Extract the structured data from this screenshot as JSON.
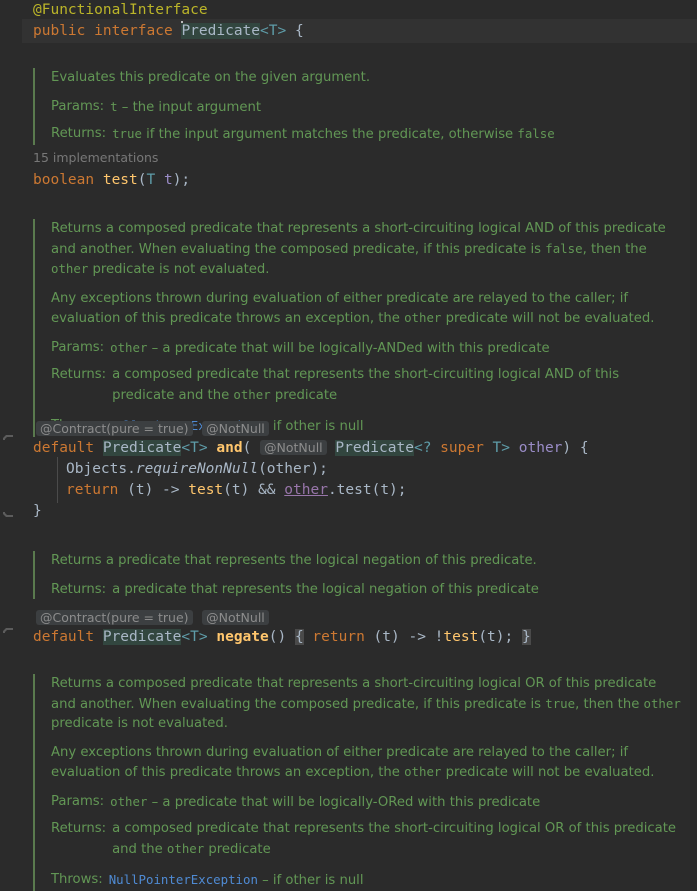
{
  "editor": {
    "theme": "darcula",
    "background": "#2b2b2b",
    "caret_line_background": "#323232",
    "doc_accent": "#5a7a4e",
    "keyword_color": "#cc7832",
    "method_color": "#ffc66d",
    "doc_text_color": "#629755",
    "link_color": "#4f8bd4",
    "hint_color": "#8c8c8c"
  },
  "code": {
    "annotation_line": "@FunctionalInterface",
    "declaration": {
      "kw_public": "public",
      "kw_interface": "interface",
      "name": "Predicate",
      "generic": "<T>",
      "brace": "{"
    },
    "test_method": {
      "code_vision": "15 implementations",
      "kw_boolean": "boolean",
      "name": "test",
      "open_paren": "(",
      "param_type": "T",
      "param_name": "t",
      "close": ");"
    },
    "and_method": {
      "hints": [
        "@Contract(pure = true)",
        "@NotNull"
      ],
      "kw_default": "default",
      "return_type": "Predicate",
      "return_generic": "<T>",
      "name": "and",
      "open_paren": "(",
      "param_hint": "@NotNull",
      "param_type": "Predicate",
      "param_generic": "<? ",
      "kw_super": "super",
      "param_generic_tail": " T>",
      "param_name": "other",
      "close_paren": ")",
      "open_brace": "{",
      "body": [
        {
          "obj": "Objects",
          "dot": ".",
          "call": "requireNonNull",
          "args": "(other);"
        },
        {
          "kw": "return",
          "lambda": " (t) -> ",
          "call1": "test",
          "call1args": "(t) ",
          "op": "&&",
          "ref": "other",
          "tail": ".test(t);"
        }
      ],
      "close_brace": "}"
    },
    "negate_method": {
      "hints": [
        "@Contract(pure = true)",
        "@NotNull"
      ],
      "kw_default": "default",
      "return_type": "Predicate",
      "return_generic": "<T>",
      "name": "negate",
      "parens": "()",
      "open_brace": "{",
      "kw_return": "return",
      "lambda": " (t) -> !",
      "call": "test",
      "call_args": "(t);",
      "close_brace": "}"
    }
  },
  "docs": {
    "test": {
      "summary": "Evaluates this predicate on the given argument.",
      "params_label": "Params:",
      "param_name": "t",
      "param_dash": "–",
      "param_desc": "the input argument",
      "returns_label": "Returns:",
      "returns_pre": "",
      "returns_true": "true",
      "returns_mid": " if the input argument matches the predicate, otherwise ",
      "returns_false": "false"
    },
    "and": {
      "para1_a": "Returns a composed predicate that represents a short-circuiting logical AND of this predicate and another. When evaluating the composed predicate, if this predicate is ",
      "para1_false": "false",
      "para1_b": ", then the ",
      "para1_other": "other",
      "para1_c": " predicate is not evaluated.",
      "para2_a": "Any exceptions thrown during evaluation of either predicate are relayed to the caller; if evaluation of this predicate throws an exception, the ",
      "para2_other": "other",
      "para2_b": " predicate will not be evaluated.",
      "params_label": "Params:",
      "param_name": "other",
      "param_dash": "–",
      "param_desc": "a predicate that will be logically-ANDed with this predicate",
      "returns_label": "Returns:",
      "returns_a": "a composed predicate that represents the short-circuiting logical AND of this predicate and the ",
      "returns_other": "other",
      "returns_b": " predicate",
      "throws_label": "Throws:",
      "throws_type": "NullPointerException",
      "throws_dash": "–",
      "throws_desc": "if other is null"
    },
    "negate": {
      "summary": "Returns a predicate that represents the logical negation of this predicate.",
      "returns_label": "Returns:",
      "returns_text": "a predicate that represents the logical negation of this predicate"
    },
    "or": {
      "para1_a": "Returns a composed predicate that represents a short-circuiting logical OR of this predicate and another. When evaluating the composed predicate, if this predicate is ",
      "para1_true": "true",
      "para1_b": ", then the ",
      "para1_other": "other",
      "para1_c": " predicate is not evaluated.",
      "para2_a": "Any exceptions thrown during evaluation of either predicate are relayed to the caller; if evaluation of this predicate throws an exception, the ",
      "para2_other": "other",
      "para2_b": " predicate will not be evaluated.",
      "params_label": "Params:",
      "param_name": "other",
      "param_dash": "–",
      "param_desc": "a predicate that will be logically-ORed with this predicate",
      "returns_label": "Returns:",
      "returns_a": "a composed predicate that represents the short-circuiting logical OR of this predicate and the ",
      "returns_other": "other",
      "returns_b": " predicate",
      "throws_label": "Throws:",
      "throws_type": "NullPointerException",
      "throws_dash": "–",
      "throws_desc": "if other is null"
    }
  }
}
